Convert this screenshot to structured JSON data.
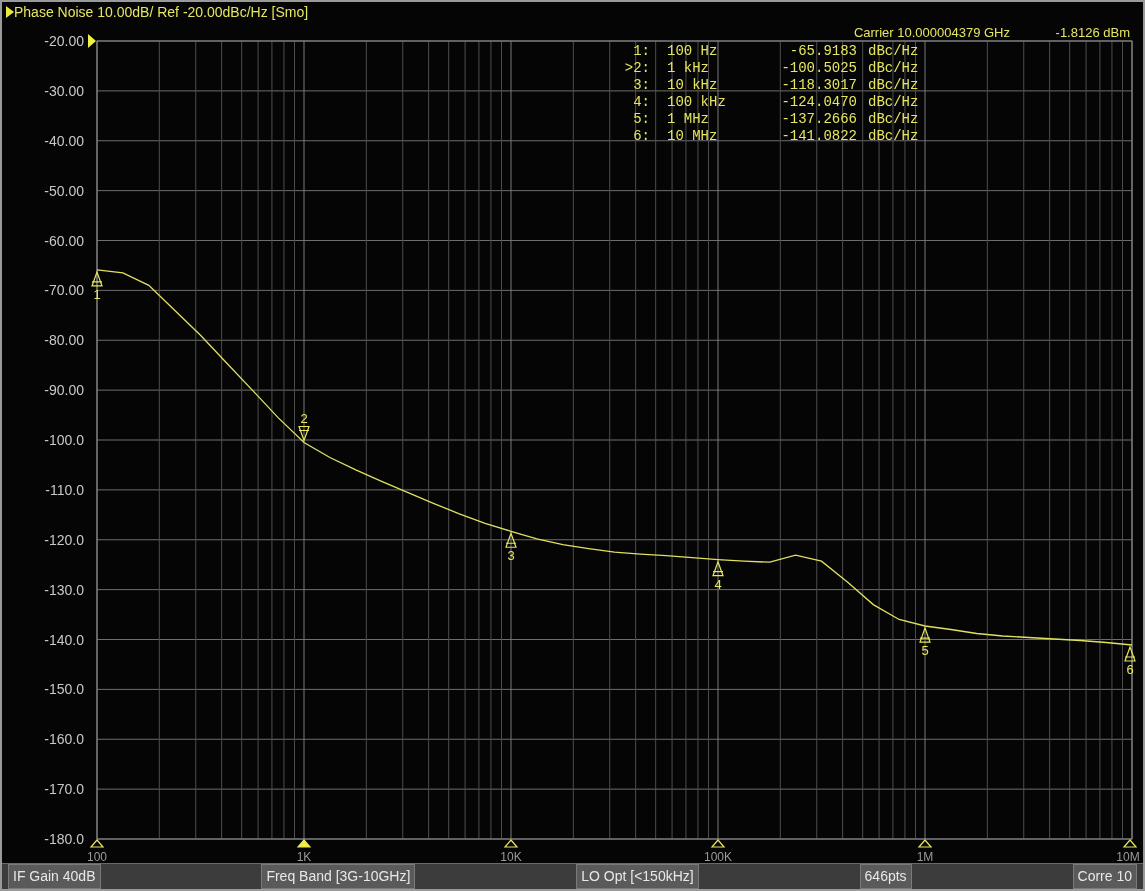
{
  "header": {
    "title": "Phase Noise 10.00dB/ Ref -20.00dBc/Hz [Smo]",
    "carrier": "Carrier 10.000004379 GHz",
    "power": "-1.8126 dBm"
  },
  "marker_table": [
    {
      "label": "1:",
      "frequency": "100 Hz",
      "value": "-65.9183",
      "unit": "dBc/Hz",
      "selected": false
    },
    {
      "label": ">2:",
      "frequency": "1 kHz",
      "value": "-100.5025",
      "unit": "dBc/Hz",
      "selected": true
    },
    {
      "label": "3:",
      "frequency": "10 kHz",
      "value": "-118.3017",
      "unit": "dBc/Hz",
      "selected": false
    },
    {
      "label": "4:",
      "frequency": "100 kHz",
      "value": "-124.0470",
      "unit": "dBc/Hz",
      "selected": false
    },
    {
      "label": "5:",
      "frequency": "1 MHz",
      "value": "-137.2666",
      "unit": "dBc/Hz",
      "selected": false
    },
    {
      "label": "6:",
      "frequency": "10 MHz",
      "value": "-141.0822",
      "unit": "dBc/Hz",
      "selected": false
    }
  ],
  "chart_data": {
    "type": "line",
    "grid": true,
    "categories": [
      "100",
      null,
      null,
      null,
      null,
      null,
      null,
      null,
      "1K",
      null,
      null,
      null,
      null,
      null,
      null,
      null,
      "10K",
      null,
      null,
      null,
      null,
      null,
      null,
      null,
      "100K",
      null,
      null,
      null,
      null,
      null,
      null,
      null,
      "1M",
      null,
      null,
      null,
      null,
      null,
      null,
      null,
      "10M"
    ],
    "series": [
      {
        "color": "#e0e060",
        "values": [
          -65.9,
          -66.5,
          -69,
          -74,
          -79,
          -84.5,
          -90,
          -95.5,
          -100.5,
          -103.5,
          -106,
          -108.3,
          -110.5,
          -112.7,
          -114.8,
          -116.7,
          -118.3,
          -119.8,
          -121,
          -121.8,
          -122.5,
          -122.9,
          -123.2,
          -123.6,
          -124,
          -124.3,
          -124.5,
          -123.1,
          -124.3,
          -128.5,
          -133,
          -136,
          -137.3,
          -138,
          -138.8,
          -139.3,
          -139.6,
          -139.9,
          -140.2,
          -140.6,
          -141.1
        ]
      }
    ],
    "ylim": [
      -180,
      -20
    ],
    "yticks": [
      {
        "value": -20,
        "label": "-20.00"
      },
      {
        "value": -30,
        "label": "-30.00"
      },
      {
        "value": -40,
        "label": "-40.00"
      },
      {
        "value": -50,
        "label": "-50.00"
      },
      {
        "value": -60,
        "label": "-60.00"
      },
      {
        "value": -70,
        "label": "-70.00"
      },
      {
        "value": -80,
        "label": "-80.00"
      },
      {
        "value": -90,
        "label": "-90.00"
      },
      {
        "value": -100,
        "label": "-100.0"
      },
      {
        "value": -110,
        "label": "-110.0"
      },
      {
        "value": -120,
        "label": "-120.0"
      },
      {
        "value": -130,
        "label": "-130.0"
      },
      {
        "value": -140,
        "label": "-140.0"
      },
      {
        "value": -150,
        "label": "-150.0"
      },
      {
        "value": -160,
        "label": "-160.0"
      },
      {
        "value": -170,
        "label": "-170.0"
      },
      {
        "value": -180,
        "label": "-180.0"
      }
    ],
    "annotations": [
      "1",
      "2",
      "3",
      "4",
      "5",
      "6"
    ]
  },
  "status_bar": [
    "IF Gain 40dB",
    "Freq Band [3G-10GHz]",
    "LO Opt [<150kHz]",
    "646pts",
    "Corre 10"
  ]
}
